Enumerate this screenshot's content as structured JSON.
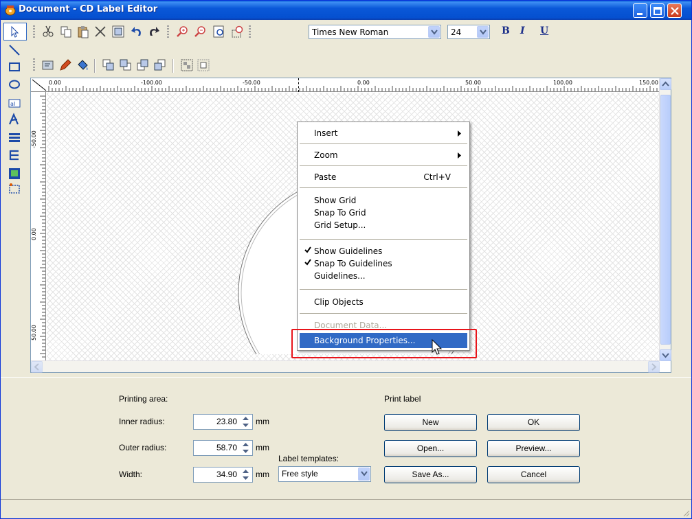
{
  "window": {
    "title": "Document - CD Label Editor"
  },
  "toolbar": {
    "font_family": "Times New Roman",
    "font_size": "24",
    "bold_label": "B",
    "italic_label": "I",
    "underline_label": "U"
  },
  "ruler": {
    "top_labels": [
      "0.00",
      "-100.00",
      "-50.00",
      "0.00",
      "50.00",
      "100.00",
      "150.00"
    ],
    "left_labels": [
      "-50.00",
      "0.00",
      "50.00"
    ]
  },
  "context_menu": {
    "items": [
      {
        "label": "Insert",
        "submenu": true
      },
      {
        "label": "Zoom",
        "submenu": true
      },
      {
        "label": "Paste",
        "shortcut": "Ctrl+V"
      },
      {
        "label": "Show Grid"
      },
      {
        "label": "Snap To Grid"
      },
      {
        "label": "Grid Setup..."
      },
      {
        "label": "Show Guidelines",
        "checked": true
      },
      {
        "label": "Snap To Guidelines",
        "checked": true
      },
      {
        "label": "Guidelines..."
      },
      {
        "label": "Clip Objects"
      },
      {
        "label": "Document Data...",
        "disabled": true
      },
      {
        "label": "Background Properties...",
        "highlighted": true
      }
    ]
  },
  "printing_area": {
    "heading": "Printing area:",
    "inner_radius_label": "Inner radius:",
    "inner_radius_value": "23.80",
    "outer_radius_label": "Outer radius:",
    "outer_radius_value": "58.70",
    "width_label": "Width:",
    "width_value": "34.90",
    "unit": "mm"
  },
  "label_templates": {
    "label": "Label templates:",
    "selected": "Free style"
  },
  "print_label": {
    "heading": "Print label",
    "new_label": "New",
    "open_label": "Open...",
    "save_as_label": "Save As...",
    "ok_label": "OK",
    "preview_label": "Preview...",
    "cancel_label": "Cancel"
  },
  "colors": {
    "titlebar": "#0a58d8",
    "menu_highlight": "#316ac5",
    "annotation_box": "#e8141a"
  }
}
